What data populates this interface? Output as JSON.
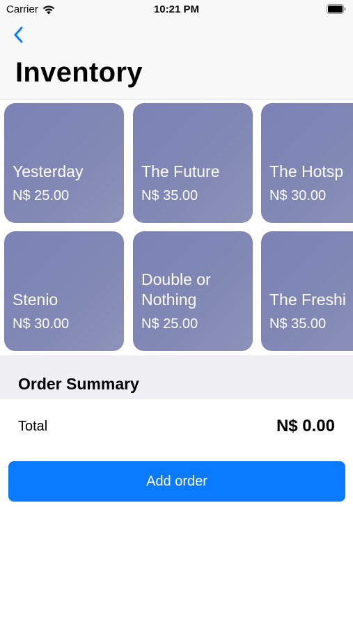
{
  "status_bar": {
    "carrier": "Carrier",
    "time": "10:21 PM",
    "wifi_icon": "wifi-icon",
    "battery_icon": "battery-icon"
  },
  "nav": {
    "back_icon": "chevron-left-icon",
    "title": "Inventory",
    "accent_color": "#0a7aff"
  },
  "products": [
    {
      "name": "Yesterday",
      "price": "N$ 25.00"
    },
    {
      "name": "The Future",
      "price": "N$ 35.00"
    },
    {
      "name": "The Hotsp",
      "price": "N$ 30.00"
    },
    {
      "name": "Stenio",
      "price": "N$ 30.00"
    },
    {
      "name": "Double or\nNothing",
      "price": "N$ 25.00"
    },
    {
      "name": "The Freshi",
      "price": "N$ 35.00"
    }
  ],
  "summary": {
    "title": "Order Summary",
    "total_label": "Total",
    "total_value": "N$ 0.00"
  },
  "actions": {
    "add_order_label": "Add order"
  }
}
